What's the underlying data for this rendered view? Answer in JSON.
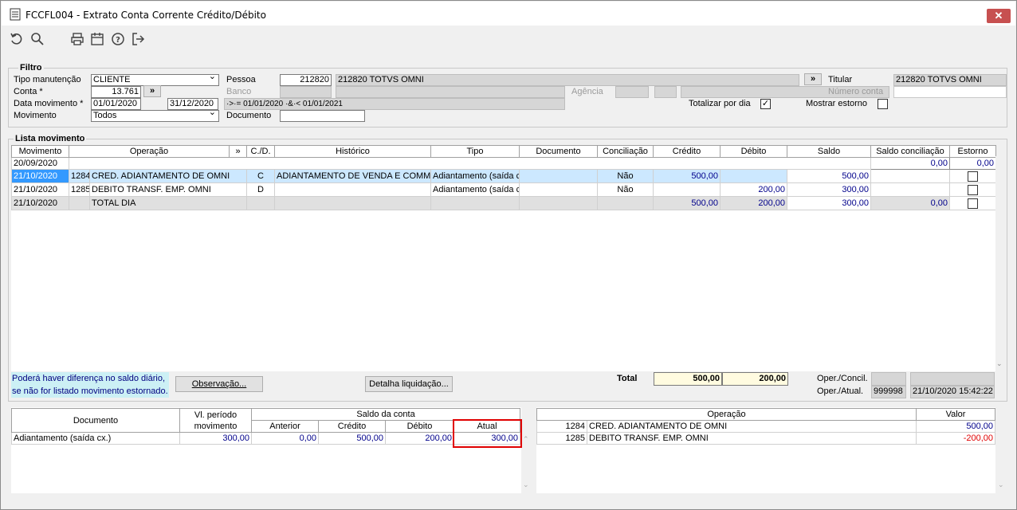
{
  "window": {
    "title": "FCCFL004 - Extrato Conta Corrente Crédito/Débito",
    "close": "✕"
  },
  "filtro": {
    "legend": "Filtro",
    "tipo_manutencao_label": "Tipo manutenção",
    "tipo_manutencao": "CLIENTE",
    "conta_label": "Conta *",
    "conta": "13.761",
    "conta_btn": "»",
    "data_mov_label": "Data movimento *",
    "data_ini": "01/01/2020",
    "data_fim": "31/12/2020",
    "data_expr": "·>·= 01/01/2020 ·&·< 01/01/2021",
    "movimento_label": "Movimento",
    "movimento": "Todos",
    "pessoa_label": "Pessoa",
    "pessoa": "212820",
    "pessoa_nome": "212820  TOTVS OMNI",
    "pessoa_btn": "»",
    "banco_label": "Banco",
    "agencia_label": "Agência",
    "documento_label": "Documento",
    "titular_label": "Titular",
    "titular": "212820  TOTVS OMNI",
    "numero_conta_label": "Número conta",
    "totalizar_label": "Totalizar por dia",
    "totalizar_checked": "✓",
    "mostrar_estorno_label": "Mostrar estorno"
  },
  "lista": {
    "legend": "Lista movimento",
    "headers": [
      "Movimento",
      "Operação",
      "»",
      "C./D.",
      "Histórico",
      "Tipo",
      "Documento",
      "Conciliação",
      "Crédito",
      "Débito",
      "Saldo",
      "Saldo conciliação",
      "Estorno"
    ],
    "rows": [
      {
        "mov": "20/09/2020",
        "op_cod": "",
        "op": "",
        "cd": "",
        "hist": "",
        "tipo": "",
        "doc": "",
        "conc": "",
        "cred": "",
        "deb": "",
        "saldo": "0,00",
        "saldo_conc": "0,00"
      },
      {
        "mov": "21/10/2020",
        "op_cod": "1284",
        "op": "CRED. ADIANTAMENTO DE OMNI",
        "cd": "C",
        "hist": "ADIANTAMENTO DE VENDA E COMMERCE",
        "tipo": "Adiantamento (saída cx.)",
        "doc": "",
        "conc": "Não",
        "cred": "500,00",
        "deb": "",
        "saldo": "500,00",
        "saldo_conc": ""
      },
      {
        "mov": "21/10/2020",
        "op_cod": "1285",
        "op": "DEBITO TRANSF. EMP. OMNI",
        "cd": "D",
        "hist": "",
        "tipo": "Adiantamento (saída cx.)",
        "doc": "",
        "conc": "Não",
        "cred": "",
        "deb": "200,00",
        "saldo": "300,00",
        "saldo_conc": ""
      },
      {
        "mov": "21/10/2020",
        "op_cod": "",
        "op": "TOTAL DIA",
        "cd": "",
        "hist": "",
        "tipo": "",
        "doc": "",
        "conc": "",
        "cred": "500,00",
        "deb": "200,00",
        "saldo": "300,00",
        "saldo_conc": "0,00"
      }
    ],
    "note_line1": "Poderá haver diferença no saldo diário,",
    "note_line2": "se não for listado movimento estornado.",
    "observacao_btn": "Observação...",
    "detalha_btn": "Detalha liquidação...",
    "total_label": "Total",
    "total_cred": "500,00",
    "total_deb": "200,00",
    "oper_concil_label": "Oper./Concil.",
    "oper_atual_label": "Oper./Atual.",
    "oper_atual_user": "999998",
    "oper_atual_dt": "21/10/2020 15:42:22"
  },
  "resumo": {
    "h_documento": "Documento",
    "h_periodo": "Vl. período movimento",
    "h_saldo": "Saldo da conta",
    "h_anterior": "Anterior",
    "h_credito": "Crédito",
    "h_debito": "Débito",
    "h_atual": "Atual",
    "row": {
      "doc": "Adiantamento (saída cx.)",
      "periodo": "300,00",
      "anterior": "0,00",
      "credito": "500,00",
      "debito": "200,00",
      "atual": "300,00"
    }
  },
  "operacoes": {
    "h_operacao": "Operação",
    "h_valor": "Valor",
    "rows": [
      {
        "cod": "1284",
        "nome": "CRED. ADIANTAMENTO DE OMNI",
        "valor": "500,00"
      },
      {
        "cod": "1285",
        "nome": "DEBITO TRANSF. EMP. OMNI",
        "valor": "-200,00"
      }
    ]
  },
  "colors": {
    "highlight_border": "#e00000",
    "selection": "#cce8ff",
    "total_bg": "#fffbe0"
  }
}
